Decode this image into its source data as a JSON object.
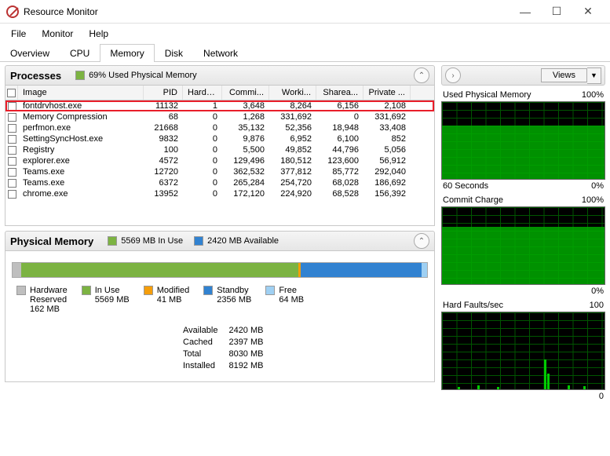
{
  "window": {
    "title": "Resource Monitor"
  },
  "menu": {
    "file": "File",
    "monitor": "Monitor",
    "help": "Help"
  },
  "tabs": {
    "overview": "Overview",
    "cpu": "CPU",
    "memory": "Memory",
    "disk": "Disk",
    "network": "Network"
  },
  "processes": {
    "title": "Processes",
    "legend": "69% Used Physical Memory",
    "cols": {
      "image": "Image",
      "pid": "PID",
      "hard": "Hard F...",
      "commit": "Commi...",
      "work": "Worki...",
      "share": "Sharea...",
      "priv": "Private ..."
    },
    "rows": [
      {
        "image": "fontdrvhost.exe",
        "pid": "11132",
        "hf": "1",
        "com": "3,648",
        "wrk": "8,264",
        "shr": "6,156",
        "prv": "2,108",
        "hl": true
      },
      {
        "image": "Memory Compression",
        "pid": "68",
        "hf": "0",
        "com": "1,268",
        "wrk": "331,692",
        "shr": "0",
        "prv": "331,692"
      },
      {
        "image": "perfmon.exe",
        "pid": "21668",
        "hf": "0",
        "com": "35,132",
        "wrk": "52,356",
        "shr": "18,948",
        "prv": "33,408"
      },
      {
        "image": "SettingSyncHost.exe",
        "pid": "9832",
        "hf": "0",
        "com": "9,876",
        "wrk": "6,952",
        "shr": "6,100",
        "prv": "852"
      },
      {
        "image": "Registry",
        "pid": "100",
        "hf": "0",
        "com": "5,500",
        "wrk": "49,852",
        "shr": "44,796",
        "prv": "5,056"
      },
      {
        "image": "explorer.exe",
        "pid": "4572",
        "hf": "0",
        "com": "129,496",
        "wrk": "180,512",
        "shr": "123,600",
        "prv": "56,912"
      },
      {
        "image": "Teams.exe",
        "pid": "12720",
        "hf": "0",
        "com": "362,532",
        "wrk": "377,812",
        "shr": "85,772",
        "prv": "292,040"
      },
      {
        "image": "Teams.exe",
        "pid": "6372",
        "hf": "0",
        "com": "265,284",
        "wrk": "254,720",
        "shr": "68,028",
        "prv": "186,692"
      },
      {
        "image": "chrome.exe",
        "pid": "13952",
        "hf": "0",
        "com": "172,120",
        "wrk": "224,920",
        "shr": "68,528",
        "prv": "156,392"
      }
    ]
  },
  "physmem": {
    "title": "Physical Memory",
    "inuse": "5569 MB In Use",
    "avail": "2420 MB Available",
    "legend": {
      "hw": {
        "label": "Hardware",
        "sub": "Reserved",
        "val": "162 MB",
        "color": "#bfbfbf"
      },
      "in": {
        "label": "In Use",
        "val": "5569 MB",
        "color": "#7cb342"
      },
      "mod": {
        "label": "Modified",
        "val": "41 MB",
        "color": "#f59e0b"
      },
      "stb": {
        "label": "Standby",
        "val": "2356 MB",
        "color": "#3182d1"
      },
      "fre": {
        "label": "Free",
        "val": "64 MB",
        "color": "#9fd0f3"
      }
    },
    "stats": {
      "labels": {
        "a": "Available",
        "c": "Cached",
        "t": "Total",
        "i": "Installed"
      },
      "vals": {
        "a": "2420 MB",
        "c": "2397 MB",
        "t": "8030 MB",
        "i": "8192 MB"
      }
    }
  },
  "views": "Views",
  "graphs": {
    "g1": {
      "title": "Used Physical Memory",
      "max": "100%",
      "footL": "60 Seconds",
      "footR": "0%",
      "fill": 69
    },
    "g2": {
      "title": "Commit Charge",
      "max": "100%",
      "footR": "0%",
      "fill": 74
    },
    "g3": {
      "title": "Hard Faults/sec",
      "max": "100",
      "footR": "0",
      "fill": 0
    }
  }
}
